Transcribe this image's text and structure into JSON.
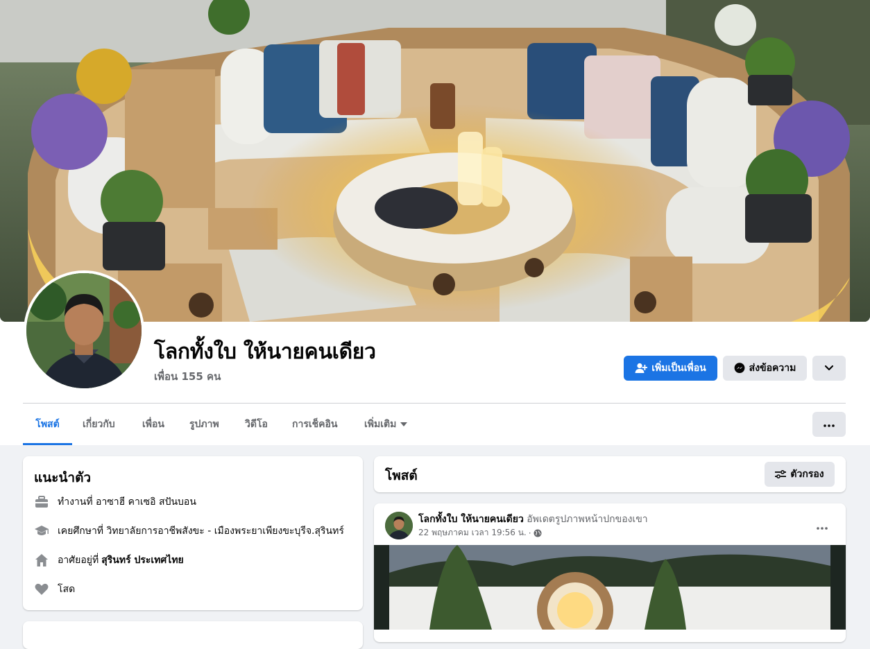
{
  "profile": {
    "name": "โลกทั้งใบ ให้นายคนเดียว",
    "friends": "เพื่อน 155 คน"
  },
  "actions": {
    "add_friend": "เพิ่มเป็นเพื่อน",
    "message": "ส่งข้อความ"
  },
  "tabs": [
    {
      "label": "โพสต์",
      "active": true
    },
    {
      "label": "เกี่ยวกับ"
    },
    {
      "label": "เพื่อน"
    },
    {
      "label": "รูปภาพ"
    },
    {
      "label": "วิดีโอ"
    },
    {
      "label": "การเช็คอิน"
    },
    {
      "label": "เพิ่มเติม"
    }
  ],
  "intro": {
    "title": "แนะนำตัว",
    "work": "ทำงานที่ อาซาฮี คาเซอิ สปันบอน",
    "education": "เคยศึกษาที่ วิทยาลัยการอาชีพสังขะ - เมืองพระยาเพียงขะบุรีจ.สุรินทร์",
    "lives_prefix": "อาศัยอยู่ที่",
    "lives_place": "สุรินทร์ ประเทศไทย",
    "relationship": "โสด"
  },
  "posts_header": {
    "title": "โพสต์",
    "filter": "ตัวกรอง"
  },
  "post": {
    "author": "โลกทั้งใบ ให้นายคนเดียว",
    "action": "อัพเดตรูปภาพหน้าปกของเขา",
    "date": "22 พฤษภาคม เวลา 19:56 น.",
    "sep": "·"
  },
  "colors": {
    "accent": "#1b74e4",
    "page_bg": "#f0f2f5",
    "secondary_text": "#65676b"
  }
}
